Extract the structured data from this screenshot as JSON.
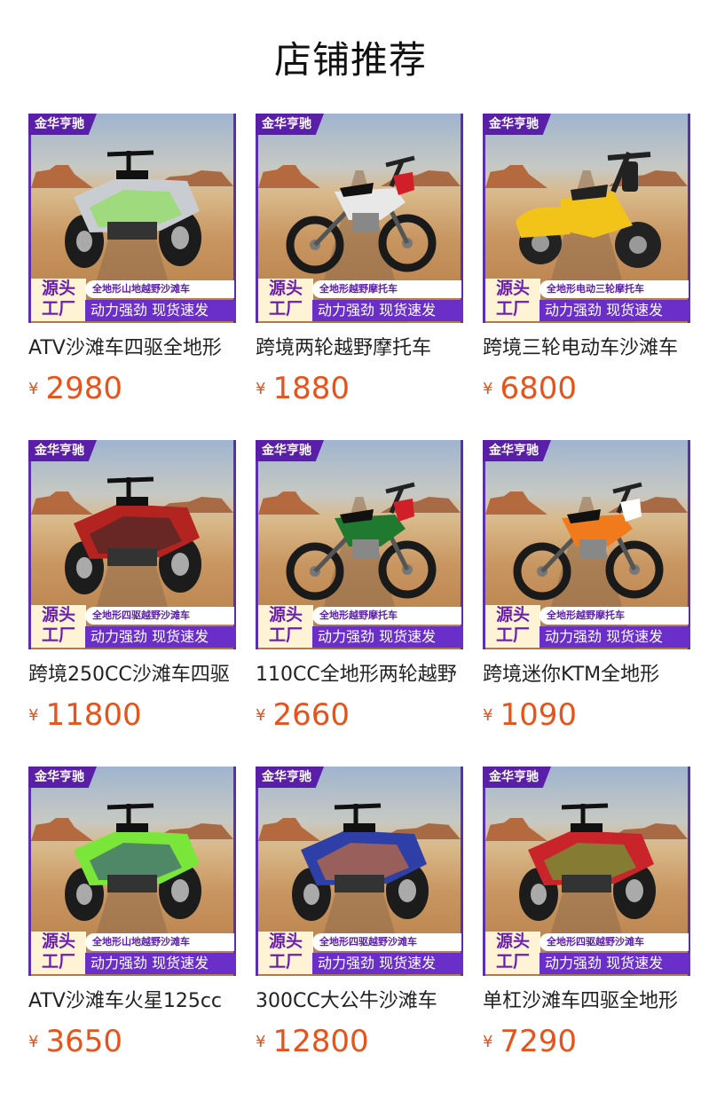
{
  "page_title": "店铺推荐",
  "currency_symbol": "¥",
  "products": [
    {
      "brand": "金华亨驰",
      "badge_line1": "源头",
      "badge_line2": "工厂",
      "tag_top": "全地形山地越野沙滩车",
      "tag_bottom": "动力强劲 现货速发",
      "name": "ATV沙滩车四驱全地形",
      "price": "2980",
      "vehicle": "atv",
      "color": "#c9ccd0",
      "accent": "#7be63a"
    },
    {
      "brand": "金华亨驰",
      "badge_line1": "源头",
      "badge_line2": "工厂",
      "tag_top": "全地形越野摩托车",
      "tag_bottom": "动力强劲 现货速发",
      "name": "跨境两轮越野摩托车",
      "price": "1880",
      "vehicle": "dirtbike",
      "color": "#e8e8e8",
      "accent": "#d11f2a"
    },
    {
      "brand": "金华亨驰",
      "badge_line1": "源头",
      "badge_line2": "工厂",
      "tag_top": "全地形电动三轮摩托车",
      "tag_bottom": "动力强劲 现货速发",
      "name": "跨境三轮电动车沙滩车",
      "price": "6800",
      "vehicle": "trike",
      "color": "#f2c318",
      "accent": "#222222"
    },
    {
      "brand": "金华亨驰",
      "badge_line1": "源头",
      "badge_line2": "工厂",
      "tag_top": "全地形四驱越野沙滩车",
      "tag_bottom": "动力强劲 现货速发",
      "name": "跨境250CC沙滩车四驱",
      "price": "11800",
      "vehicle": "atv",
      "color": "#b3231f",
      "accent": "#2a2a2a"
    },
    {
      "brand": "金华亨驰",
      "badge_line1": "源头",
      "badge_line2": "工厂",
      "tag_top": "全地形越野摩托车",
      "tag_bottom": "动力强劲 现货速发",
      "name": "110CC全地形两轮越野",
      "price": "2660",
      "vehicle": "dirtbike",
      "color": "#1f7a2f",
      "accent": "#d11f2a"
    },
    {
      "brand": "金华亨驰",
      "badge_line1": "源头",
      "badge_line2": "工厂",
      "tag_top": "全地形越野摩托车",
      "tag_bottom": "动力强劲 现货速发",
      "name": "跨境迷你KTM全地形",
      "price": "1090",
      "vehicle": "dirtbike",
      "color": "#f07a1c",
      "accent": "#ffffff"
    },
    {
      "brand": "金华亨驰",
      "badge_line1": "源头",
      "badge_line2": "工厂",
      "tag_top": "全地形山地越野沙滩车",
      "tag_bottom": "动力强劲 现货速发",
      "name": "ATV沙滩车火星125cc",
      "price": "3650",
      "vehicle": "atv",
      "color": "#7be63a",
      "accent": "#2b3a8a"
    },
    {
      "brand": "金华亨驰",
      "badge_line1": "源头",
      "badge_line2": "工厂",
      "tag_top": "全地形四驱越野沙滩车",
      "tag_bottom": "动力强劲 现货速发",
      "name": "300CC大公牛沙滩车",
      "price": "12800",
      "vehicle": "atv",
      "color": "#2f3fa8",
      "accent": "#f07a1c"
    },
    {
      "brand": "金华亨驰",
      "badge_line1": "源头",
      "badge_line2": "工厂",
      "tag_top": "全地形四驱越野沙滩车",
      "tag_bottom": "动力强劲 现货速发",
      "name": "单杠沙滩车四驱全地形",
      "price": "7290",
      "vehicle": "atv",
      "color": "#c8242a",
      "accent": "#4fc23a"
    }
  ]
}
